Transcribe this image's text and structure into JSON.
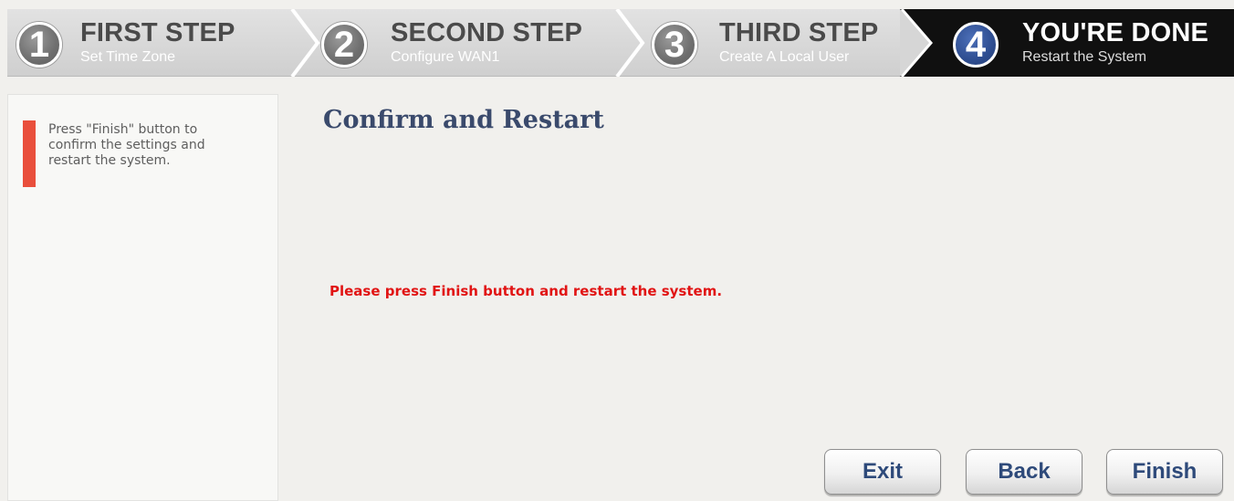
{
  "wizard": {
    "steps": [
      {
        "number": "1",
        "title": "FIRST STEP",
        "subtitle": "Set Time Zone"
      },
      {
        "number": "2",
        "title": "SECOND STEP",
        "subtitle": "Configure WAN1"
      },
      {
        "number": "3",
        "title": "THIRD STEP",
        "subtitle": "Create A Local User"
      },
      {
        "number": "4",
        "title": "YOU'RE DONE",
        "subtitle": "Restart the System"
      }
    ],
    "active_step": 4
  },
  "sidebar": {
    "help_text": "Press \"Finish\" button to confirm the settings and restart the system."
  },
  "main": {
    "title": "Confirm and Restart",
    "message": "Please press Finish button and restart the system."
  },
  "buttons": {
    "exit_label": "Exit",
    "back_label": "Back",
    "finish_label": "Finish"
  },
  "colors": {
    "accent": "#e94f3c",
    "message": "#e11414",
    "title": "#3a4a6c",
    "active_step_bg": "#101010",
    "active_step_number": "#2f4e91"
  }
}
